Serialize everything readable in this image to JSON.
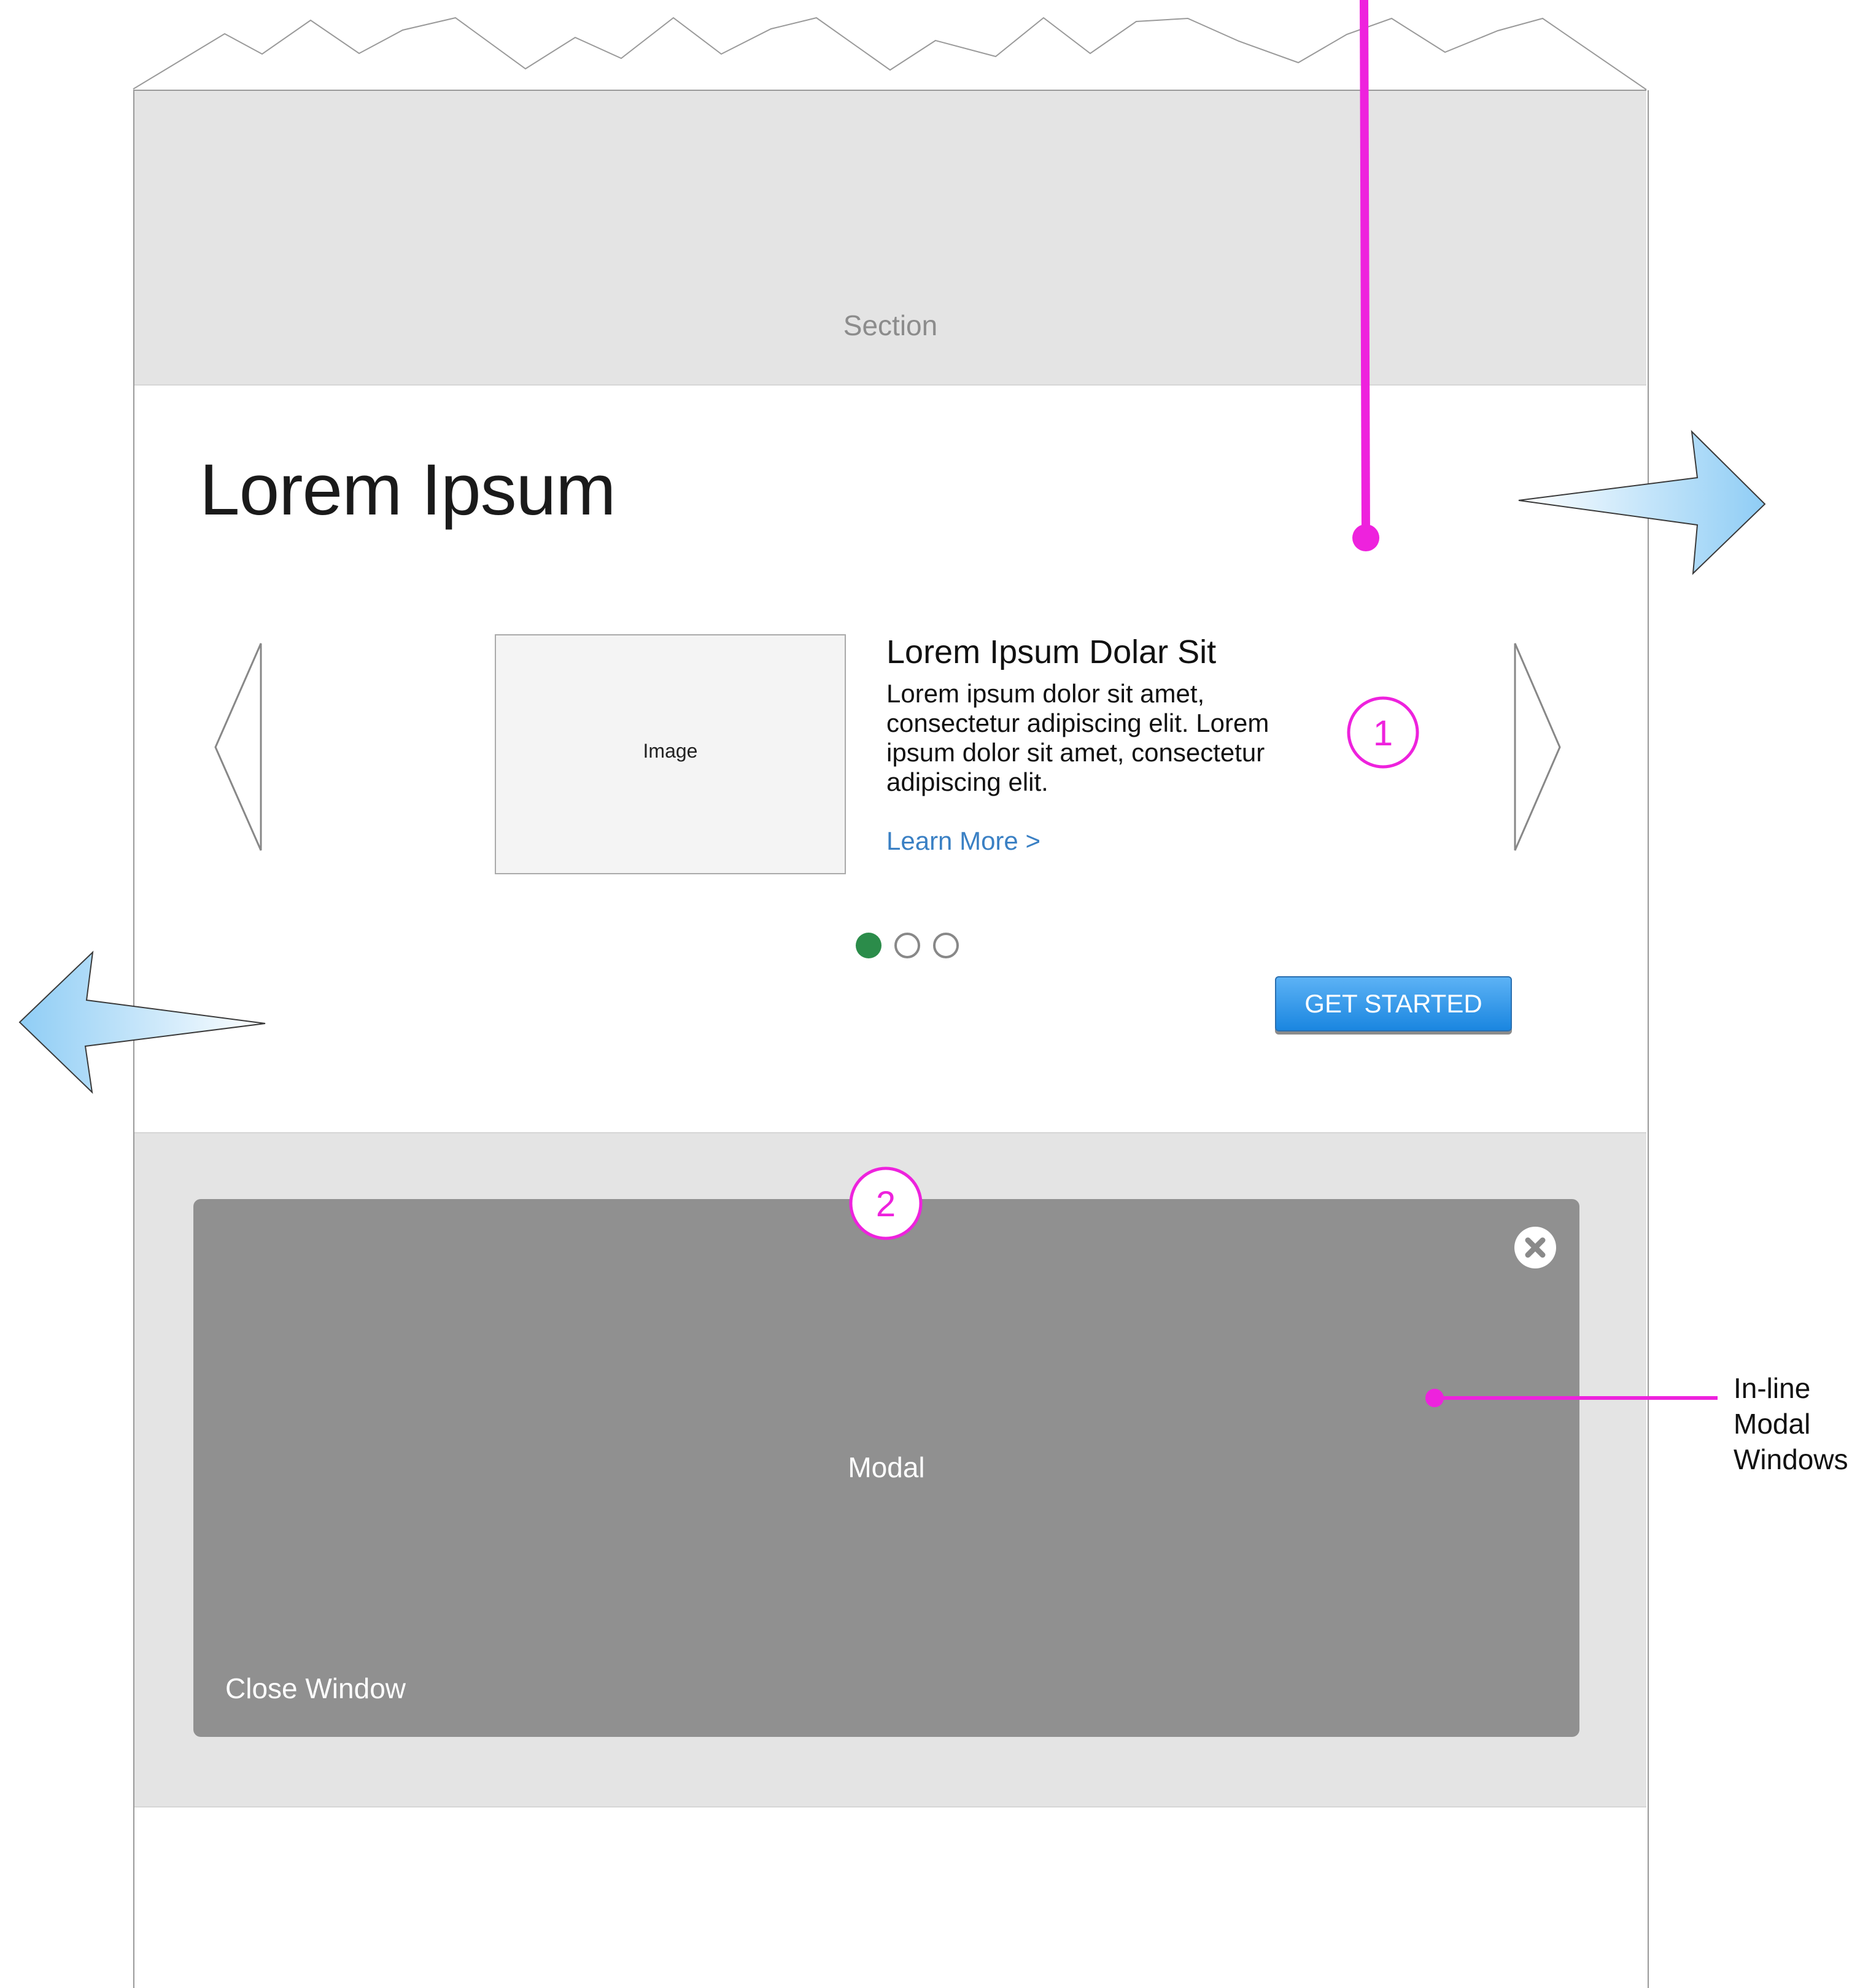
{
  "top_section": {
    "label": "Section"
  },
  "main": {
    "title": "Lorem Ipsum",
    "carousel": {
      "image_label": "Image",
      "card_title": "Lorem Ipsum Dolar Sit",
      "card_body": "Lorem ipsum dolor sit amet, consectetur adipiscing elit. Lorem ipsum dolor sit amet, consectetur adipiscing elit.",
      "learn_more": "Learn More >",
      "active_page": 1,
      "page_count": 3
    },
    "cta_label": "GET STARTED"
  },
  "modal_section": {
    "modal_label": "Modal",
    "close_link": "Close Window",
    "close_icon": "close-icon"
  },
  "annotations": {
    "badge_1": "1",
    "badge_2": "2",
    "callout_lines": [
      "In-line",
      "Modal",
      "Windows"
    ]
  },
  "colors": {
    "section_bg": "#e4e4e4",
    "modal_bg": "#909090",
    "annotation": "#ee22dd",
    "active_dot": "#2b8c4a",
    "link": "#3a80c4",
    "cta_top": "#5cb2f5",
    "cta_bottom": "#1a86e0",
    "direction_arrow": "#a6d7f7"
  }
}
